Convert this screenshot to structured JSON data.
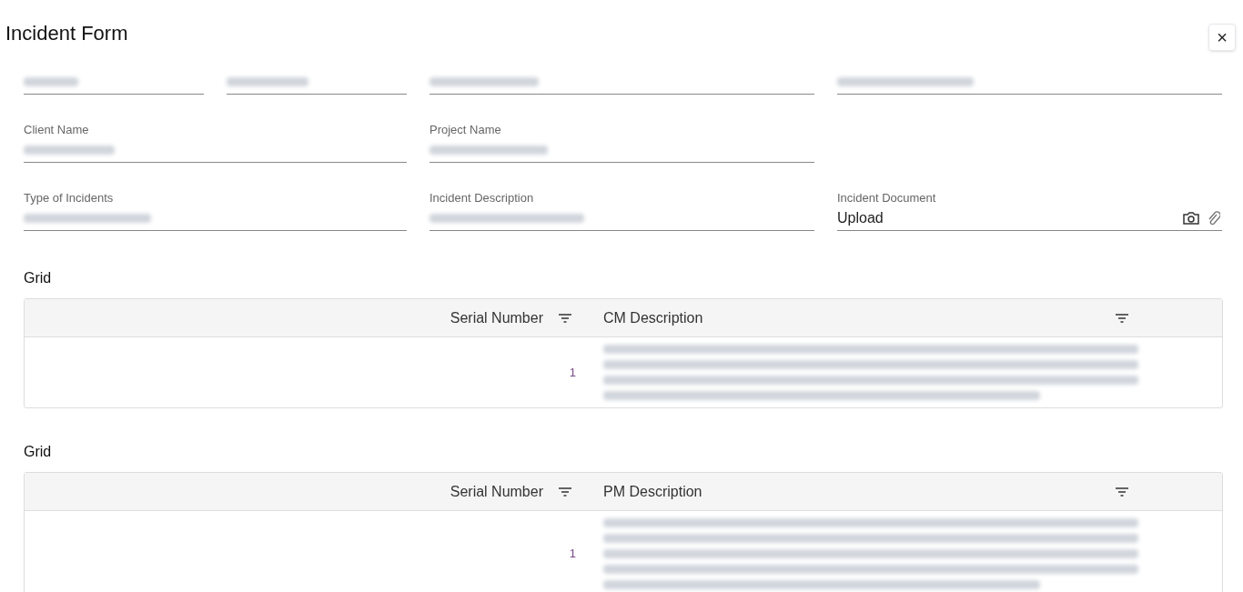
{
  "title": "Incident Form",
  "close_button": "×",
  "field_rows": [
    [
      {
        "kind": "redacted"
      },
      {
        "kind": "redacted"
      },
      {
        "kind": "redacted"
      },
      {
        "kind": "redacted"
      }
    ],
    [
      {
        "kind": "redacted",
        "label": "Client Name"
      },
      {
        "kind": "redacted",
        "label": "Project Name"
      }
    ],
    [
      {
        "kind": "redacted",
        "label": "Type of Incidents"
      },
      {
        "kind": "redacted",
        "label": "Incident Description"
      },
      {
        "kind": "upload",
        "label": "Incident Document",
        "value": "Upload"
      }
    ]
  ],
  "grids": [
    {
      "title": "Grid",
      "columns": [
        "Serial Number",
        "CM Description"
      ],
      "rows": [
        {
          "serial": "1"
        }
      ]
    },
    {
      "title": "Grid",
      "columns": [
        "Serial Number",
        "PM Description"
      ],
      "rows": [
        {
          "serial": "1"
        }
      ]
    }
  ]
}
